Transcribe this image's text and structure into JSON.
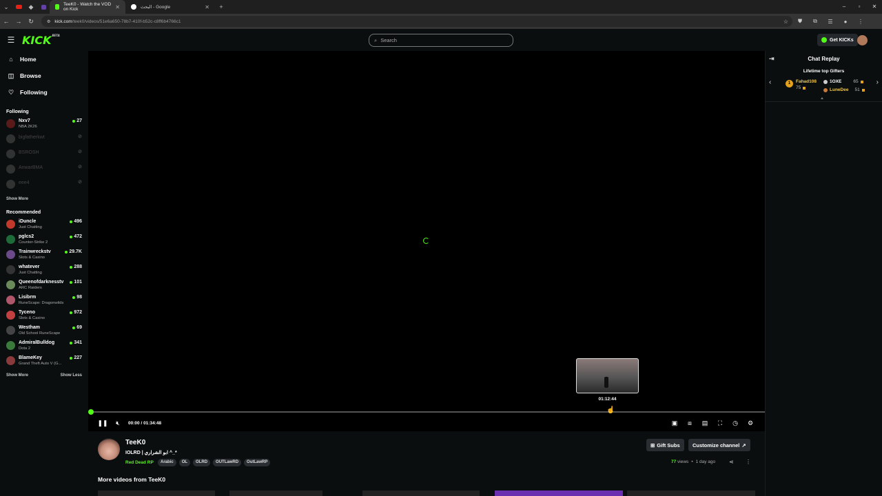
{
  "browser": {
    "tabs": [
      {
        "title": "TeeK0 - Watch the VOD on Kick",
        "active": true
      },
      {
        "title": "البحث - Google"
      }
    ],
    "url_host": "kick.com",
    "url_path": "/teek0/videos/51e6a650-78b7-410f-b52c-c8ff6b4766c1"
  },
  "header": {
    "logo": "KICK",
    "logo_badge": "BETA",
    "search_placeholder": "Search",
    "get_kicks": "Get KICKs"
  },
  "sidebar": {
    "nav": [
      {
        "label": "Home",
        "icon": "home-icon"
      },
      {
        "label": "Browse",
        "icon": "compass-icon"
      },
      {
        "label": "Following",
        "icon": "heart-icon"
      }
    ],
    "following_title": "Following",
    "following": [
      {
        "name": "Nxv7",
        "category": "NBA 2K26",
        "viewers": "27",
        "live": true,
        "color": "#5a1a1a"
      },
      {
        "name": "bigfatherkwt",
        "live": false,
        "color": "#777"
      },
      {
        "name": "BSROSH",
        "live": false,
        "color": "#777"
      },
      {
        "name": "AnwarBMA",
        "live": false,
        "color": "#777"
      },
      {
        "name": "eee4",
        "live": false,
        "color": "#777"
      }
    ],
    "following_show_more": "Show More",
    "recommended_title": "Recommended",
    "recommended": [
      {
        "name": "iDuncle",
        "category": "Just Chatting",
        "viewers": "496",
        "color": "#c0392b"
      },
      {
        "name": "pglcs2",
        "category": "Counter-Strike 2",
        "viewers": "472",
        "color": "#1e6b3a"
      },
      {
        "name": "Trainwreckstv",
        "category": "Slots & Casino",
        "viewers": "29.7K",
        "color": "#6c4a8a"
      },
      {
        "name": "whatever",
        "category": "Just Chatting",
        "viewers": "288",
        "color": "#333"
      },
      {
        "name": "Queenofdarknesstv",
        "category": "ARC Raiders",
        "viewers": "101",
        "color": "#6a8a5a"
      },
      {
        "name": "Lisibrm",
        "category": "RuneScape: Dragonwilds",
        "viewers": "98",
        "color": "#b0566a"
      },
      {
        "name": "Tyceno",
        "category": "Slots & Casino",
        "viewers": "972",
        "color": "#c24040"
      },
      {
        "name": "Westham",
        "category": "Old School RuneScape",
        "viewers": "69",
        "color": "#444"
      },
      {
        "name": "AdmiralBulldog",
        "category": "Dota 2",
        "viewers": "341",
        "color": "#3a7a3a"
      },
      {
        "name": "BlameKey",
        "category": "Grand Theft Auto V (G...",
        "viewers": "227",
        "color": "#8a3a3a"
      }
    ],
    "show_more": "Show More",
    "show_less": "Show Less"
  },
  "player": {
    "preview_time": "01:12:44",
    "current_time": "00:00",
    "duration": "01:34:48",
    "time_separator": "/",
    "progress": 0.0
  },
  "chat": {
    "title": "Chat Replay",
    "gifters_title": "Lifetime top Gifters",
    "rank": "1",
    "gifters": [
      {
        "name": "Fahad108",
        "count": "75"
      },
      {
        "name": "1OXE",
        "count": "65"
      },
      {
        "name": "LuneDee",
        "count": "51"
      }
    ]
  },
  "channel": {
    "name": "TeeK0",
    "title": "IOLRD | ابو الشراري ^_*",
    "category": "Red Dead RP",
    "tags": [
      "Arabic",
      "OL",
      "OLRD",
      "OUTLawRD",
      "OutLawRP"
    ],
    "gift_subs": "Gift Subs",
    "customize": "Customize channel",
    "views": "77",
    "views_label": "views",
    "bullet": "•",
    "age": "1 day ago",
    "more_videos": "More videos from TeeK0"
  },
  "colors": {
    "accent": "#53fc18",
    "background": "#0b0e0f"
  }
}
